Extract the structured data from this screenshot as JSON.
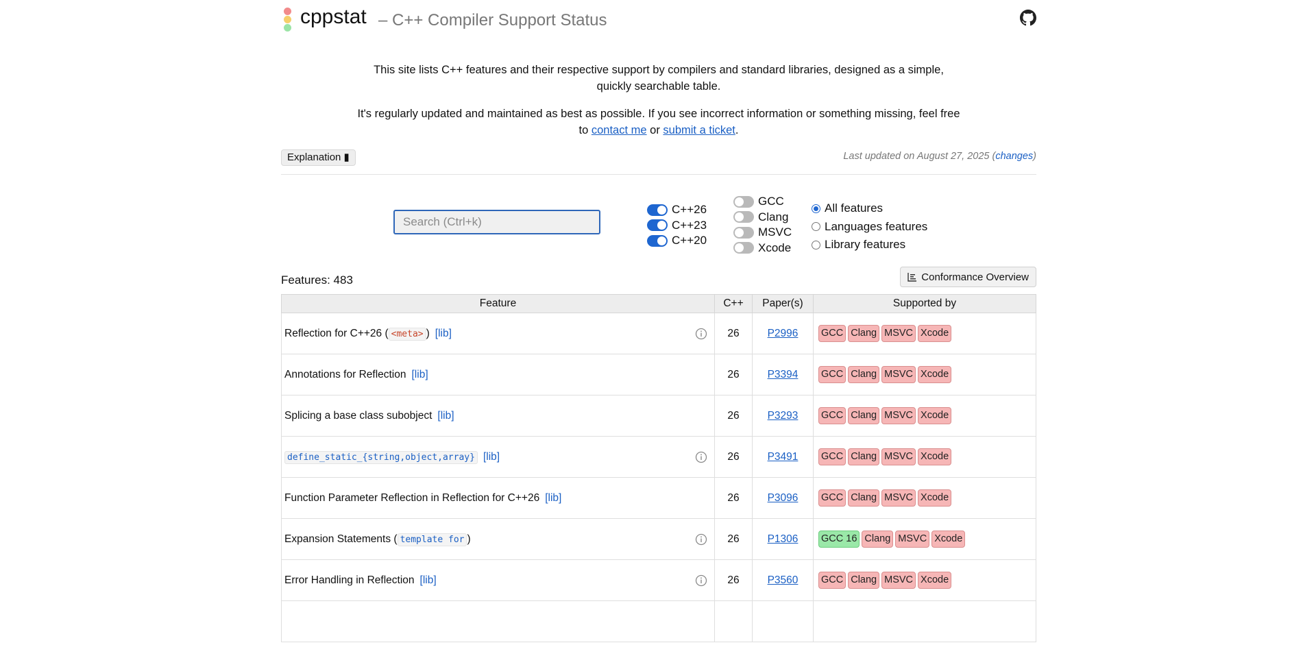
{
  "header": {
    "brand": "cppstat",
    "subtitle": "– C++ Compiler Support Status"
  },
  "intro": {
    "p1": "This site lists C++ features and their respective support by compilers and standard libraries, designed as a simple, quickly searchable table.",
    "p2_before": "It's regularly updated and maintained as best as possible. If you see incorrect information or something missing, feel free to ",
    "contact_link": "contact me",
    "p2_middle": " or ",
    "ticket_link": "submit a ticket",
    "p2_after": "."
  },
  "meta": {
    "explanation_label": "Explanation ▮",
    "updated_text": "Last updated on August 27, 2025 (",
    "changes_link": "changes",
    "updated_close": ")"
  },
  "filters": {
    "search_placeholder": "Search (Ctrl+k)",
    "standards": [
      {
        "label": "C++26",
        "on": true
      },
      {
        "label": "C++23",
        "on": true
      },
      {
        "label": "C++20",
        "on": true
      }
    ],
    "compilers": [
      {
        "label": "GCC",
        "on": false
      },
      {
        "label": "Clang",
        "on": false
      },
      {
        "label": "MSVC",
        "on": false
      },
      {
        "label": "Xcode",
        "on": false
      }
    ],
    "scope": [
      {
        "label": "All features",
        "checked": true
      },
      {
        "label": "Languages features",
        "checked": false
      },
      {
        "label": "Library features",
        "checked": false
      }
    ]
  },
  "summary": {
    "features_count": "Features: 483",
    "conformance_button": "Conformance Overview"
  },
  "table": {
    "headers": [
      "Feature",
      "C++",
      "Paper(s)",
      "Supported by"
    ],
    "rows": [
      {
        "pre": "Reflection for C++26 (",
        "code": "<meta>",
        "code_color": "red",
        "post": ")",
        "lib": "[lib]",
        "info": true,
        "cpp": "26",
        "paper": "P2996",
        "support": [
          {
            "label": "GCC",
            "ok": false
          },
          {
            "label": "Clang",
            "ok": false
          },
          {
            "label": "MSVC",
            "ok": false
          },
          {
            "label": "Xcode",
            "ok": false
          }
        ]
      },
      {
        "pre": "Annotations for Reflection",
        "code": "",
        "code_color": "",
        "post": "",
        "lib": "[lib]",
        "info": false,
        "cpp": "26",
        "paper": "P3394",
        "support": [
          {
            "label": "GCC",
            "ok": false
          },
          {
            "label": "Clang",
            "ok": false
          },
          {
            "label": "MSVC",
            "ok": false
          },
          {
            "label": "Xcode",
            "ok": false
          }
        ]
      },
      {
        "pre": "Splicing a base class subobject",
        "code": "",
        "code_color": "",
        "post": "",
        "lib": "[lib]",
        "info": false,
        "cpp": "26",
        "paper": "P3293",
        "support": [
          {
            "label": "GCC",
            "ok": false
          },
          {
            "label": "Clang",
            "ok": false
          },
          {
            "label": "MSVC",
            "ok": false
          },
          {
            "label": "Xcode",
            "ok": false
          }
        ]
      },
      {
        "pre": "",
        "code": "define_static_{string,object,array}",
        "code_color": "blue",
        "post": "",
        "lib": "[lib]",
        "info": true,
        "cpp": "26",
        "paper": "P3491",
        "support": [
          {
            "label": "GCC",
            "ok": false
          },
          {
            "label": "Clang",
            "ok": false
          },
          {
            "label": "MSVC",
            "ok": false
          },
          {
            "label": "Xcode",
            "ok": false
          }
        ]
      },
      {
        "pre": "Function Parameter Reflection in Reflection for C++26",
        "code": "",
        "code_color": "",
        "post": "",
        "lib": "[lib]",
        "info": false,
        "cpp": "26",
        "paper": "P3096",
        "support": [
          {
            "label": "GCC",
            "ok": false
          },
          {
            "label": "Clang",
            "ok": false
          },
          {
            "label": "MSVC",
            "ok": false
          },
          {
            "label": "Xcode",
            "ok": false
          }
        ]
      },
      {
        "pre": "Expansion Statements (",
        "code": "template for",
        "code_color": "blue",
        "post": ")",
        "lib": "",
        "info": true,
        "cpp": "26",
        "paper": "P1306",
        "support": [
          {
            "label": "GCC 16",
            "ok": true
          },
          {
            "label": "Clang",
            "ok": false
          },
          {
            "label": "MSVC",
            "ok": false
          },
          {
            "label": "Xcode",
            "ok": false
          }
        ]
      },
      {
        "pre": "Error Handling in Reflection",
        "code": "",
        "code_color": "",
        "post": "",
        "lib": "[lib]",
        "info": true,
        "cpp": "26",
        "paper": "P3560",
        "support": [
          {
            "label": "GCC",
            "ok": false
          },
          {
            "label": "Clang",
            "ok": false
          },
          {
            "label": "MSVC",
            "ok": false
          },
          {
            "label": "Xcode",
            "ok": false
          }
        ]
      },
      {
        "pre": "",
        "code": "",
        "code_color": "",
        "post": "",
        "lib": "",
        "info": false,
        "cpp": "",
        "paper": "",
        "support": []
      }
    ]
  },
  "colors": {
    "accent": "#1e66d0",
    "unsupported": "#f6b6b6",
    "supported": "#9ae8a8"
  }
}
